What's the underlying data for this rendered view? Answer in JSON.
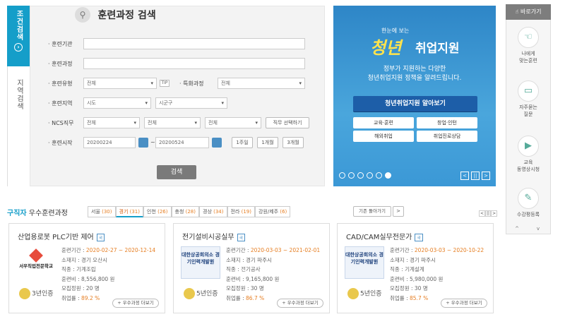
{
  "left_tabs": {
    "tab1": "조건검색",
    "tab2": "지역검색"
  },
  "search": {
    "title": "훈련과정 검색",
    "institution_label": "훈련기관",
    "course_label": "훈련과정",
    "type_label": "훈련유형",
    "type_value": "전체",
    "tip": "TIP",
    "special_label": "특화과정",
    "special_value": "전체",
    "region_label": "훈련지역",
    "region_sido": "시도",
    "region_sigungu": "시군구",
    "ncs_label": "NCS직무",
    "ncs_1": "전체",
    "ncs_2": "전체",
    "ncs_3": "전체",
    "job_select_btn": "직무 선택하기",
    "start_label": "훈련시작",
    "start_date": "20200224",
    "tilde": "~",
    "end_date": "20200524",
    "week_btn": "1주일",
    "month1_btn": "1개월",
    "month3_btn": "3개월",
    "search_btn": "검색"
  },
  "banner": {
    "small": "한눈에 보는",
    "big1": "청년",
    "big2": "취업지원",
    "sub1": "정부가 지원하는 다양한",
    "sub2": "청년취업지원 정책을 알려드립니다.",
    "main_btn": "청년취업지원 알아보기",
    "tiles": [
      "교육·훈련",
      "창업·인턴",
      "해외취업",
      "취업진로상담"
    ],
    "dots_count": 6,
    "active_dot": 6,
    "prev": "<",
    "pause": "||",
    "next": ">"
  },
  "quick_menu": {
    "title": "바로가기",
    "items": [
      {
        "label1": "나에게",
        "label2": "맞는훈련",
        "icon": "hand-pointer-icon"
      },
      {
        "label1": "자주묻는",
        "label2": "질문",
        "icon": "chat-icon"
      },
      {
        "label1": "교육",
        "label2": "동영상시청",
        "icon": "video-icon"
      },
      {
        "label1": "수강평등록",
        "label2": "",
        "icon": "pencil-icon"
      }
    ],
    "up": "^",
    "down": "v"
  },
  "bottom": {
    "title_highlight": "구직자",
    "title_rest": " 우수훈련과정",
    "region_tabs": [
      {
        "name": "서울",
        "count": "(30)"
      },
      {
        "name": "경기",
        "count": "(31)"
      },
      {
        "name": "인천",
        "count": "(26)"
      },
      {
        "name": "충청",
        "count": "(28)"
      },
      {
        "name": "경상",
        "count": "(34)"
      },
      {
        "name": "전라",
        "count": "(19)"
      },
      {
        "name": "강원/제주",
        "count": "(6)"
      }
    ],
    "active_tab": 1,
    "prev_region_btn": "기존 돌아가기",
    "next_arrow": ">",
    "page_prev": "<",
    "page_pause": "||",
    "page_next": ">",
    "cards": [
      {
        "title": "산업용로봇 PLC기반 제어",
        "badge": "국",
        "logo_text": "서우직업전문학교",
        "years": "3년인증",
        "period_label": "훈련기간 :",
        "period": "2020-02-27 ~ 2020-12-14",
        "location": "소재지 : 경기 오산시",
        "job": "직종 : 기계조립",
        "cost": "훈련비 : 8,556,800 원",
        "capacity": "모집정원 : 20 명",
        "emp_label": "취업률 :",
        "emp": "89.2 %",
        "more": "+ 우수과정 더보기"
      },
      {
        "title": "전기설비시공실무",
        "badge": "국",
        "logo_text": "대한상공회의소 경기인력개발원",
        "years": "5년인증",
        "period_label": "훈련기간 :",
        "period": "2020-03-03 ~ 2021-02-01",
        "location": "소재지 : 경기 파주시",
        "job": "직종 : 전기공사",
        "cost": "훈련비 : 9,165,800 원",
        "capacity": "모집정원 : 30 명",
        "emp_label": "취업률 :",
        "emp": "86.7 %",
        "more": "+ 우수과정 더보기"
      },
      {
        "title": "CAD/CAM실무전문가",
        "badge": "국",
        "logo_text": "대한상공회의소 경기인력개발원",
        "years": "5년인증",
        "period_label": "훈련기간 :",
        "period": "2020-03-03 ~ 2020-10-22",
        "location": "소재지 : 경기 파주시",
        "job": "직종 : 기계설계",
        "cost": "훈련비 : 5,980,000 원",
        "capacity": "모집정원 : 30 명",
        "emp_label": "취업률 :",
        "emp": "85.7 %",
        "more": "+ 우수과정 더보기"
      }
    ]
  }
}
